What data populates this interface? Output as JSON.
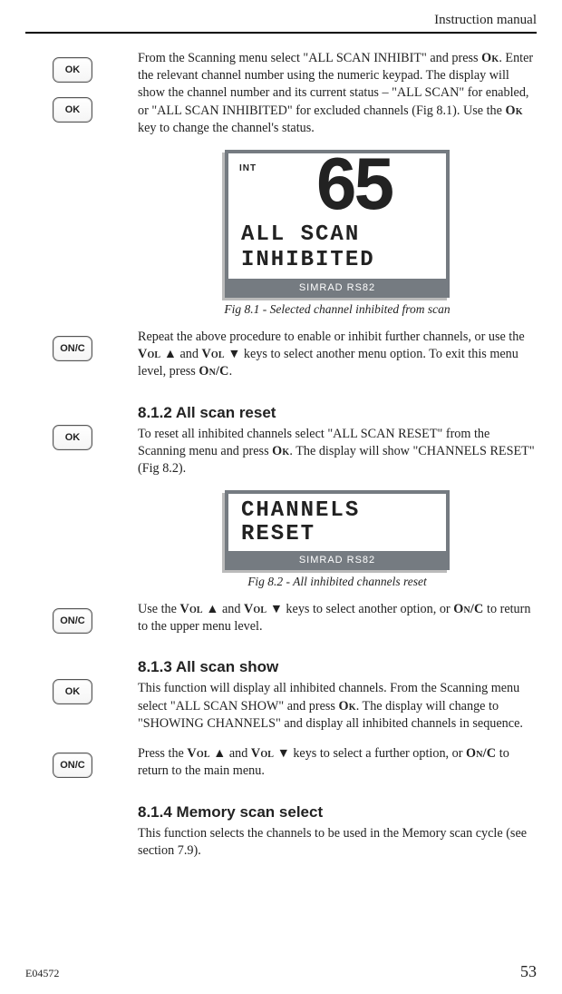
{
  "header": {
    "title": "Instruction manual"
  },
  "footer": {
    "docnum": "E04572",
    "page": "53"
  },
  "keys": {
    "ok": "OK",
    "onc": "ON/C"
  },
  "para1": {
    "t1": "From the Scanning menu select \"ALL SCAN INHIBIT\" and press ",
    "ok1": "Ok",
    "t2": ". Enter the relevant channel number using the numeric keypad. The display will show the channel number and its current status – \"ALL SCAN\" for enabled, or \"ALL SCAN INHIBITED\" for excluded channels (Fig 8.1). Use the ",
    "ok2": "Ok",
    "t3": " key to change the channel's status."
  },
  "lcd1": {
    "int": "INT",
    "number": "65",
    "line1": "ALL SCAN",
    "line2": "INHIBITED",
    "brand": "SIMRAD RS82"
  },
  "caption1": "Fig 8.1 - Selected channel inhibited from scan",
  "para2": {
    "t1": "Repeat the above procedure to enable or inhibit further channels, or use the ",
    "vol1": "Vol",
    "arrow_up": " ▲ ",
    "and1": "and ",
    "vol2": "Vol",
    "arrow_down": " ▼ ",
    "t2": "keys to select another menu option. To exit this menu level, press ",
    "onc": "On/C",
    "dot": "."
  },
  "sec812": {
    "heading": "8.1.2  All scan reset",
    "t1": "To reset all inhibited channels select \"ALL SCAN RESET\" from the Scanning menu and press ",
    "ok": "Ok",
    "t2": ". The display will show \"CHANNELS RESET\" (Fig 8.2)."
  },
  "lcd2": {
    "line1": "CHANNELS",
    "line2": "RESET",
    "brand": "SIMRAD RS82"
  },
  "caption2": "Fig 8.2 - All inhibited channels reset",
  "para3": {
    "t1": "Use the ",
    "vol1": "Vol",
    "arrow_up": " ▲ ",
    "and1": "and ",
    "vol2": "Vol",
    "arrow_down": " ▼ ",
    "t2": "keys to select another option, or ",
    "onc": "On/C",
    "t3": " to return to the upper menu level."
  },
  "sec813": {
    "heading": "8.1.3  All scan show",
    "t1": "This function will display all inhibited channels. From the Scanning menu select \"ALL SCAN SHOW\" and press ",
    "ok": "Ok",
    "t2": ". The display will change to \"SHOWING CHANNELS\" and display all inhibited channels in sequence."
  },
  "para4": {
    "t1": "Press the ",
    "vol1": "Vol",
    "arrow_up": " ▲ ",
    "and1": "and ",
    "vol2": "Vol",
    "arrow_down": " ▼ ",
    "t2": "keys to select a further option, or ",
    "onc": "On/C",
    "t3": " to return to the main menu."
  },
  "sec814": {
    "heading": "8.1.4  Memory scan select",
    "body": "This function selects the channels to be used in the Memory scan cycle (see section 7.9)."
  }
}
